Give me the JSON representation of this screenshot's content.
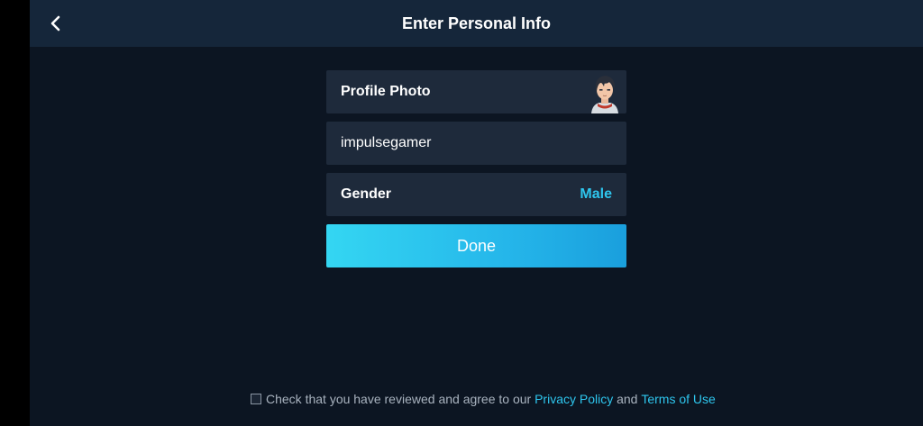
{
  "header": {
    "title": "Enter Personal Info",
    "back_icon": "chevron-left-icon"
  },
  "form": {
    "profile_photo": {
      "label": "Profile Photo",
      "avatar_icon": "anime-boy-avatar"
    },
    "username": {
      "value": "impulsegamer"
    },
    "gender": {
      "label": "Gender",
      "value": "Male"
    },
    "done_label": "Done"
  },
  "agreement": {
    "checked": false,
    "text_before": "Check that you have reviewed and agree to our",
    "privacy_link": "Privacy Policy",
    "and_text": "and",
    "terms_link": "Terms of Use"
  },
  "colors": {
    "background": "#0c1522",
    "header": "#15263a",
    "row": "#1e2a3b",
    "accent": "#2ec6ee",
    "button_gradient_start": "#34d6f2",
    "button_gradient_end": "#1a9fdd"
  }
}
